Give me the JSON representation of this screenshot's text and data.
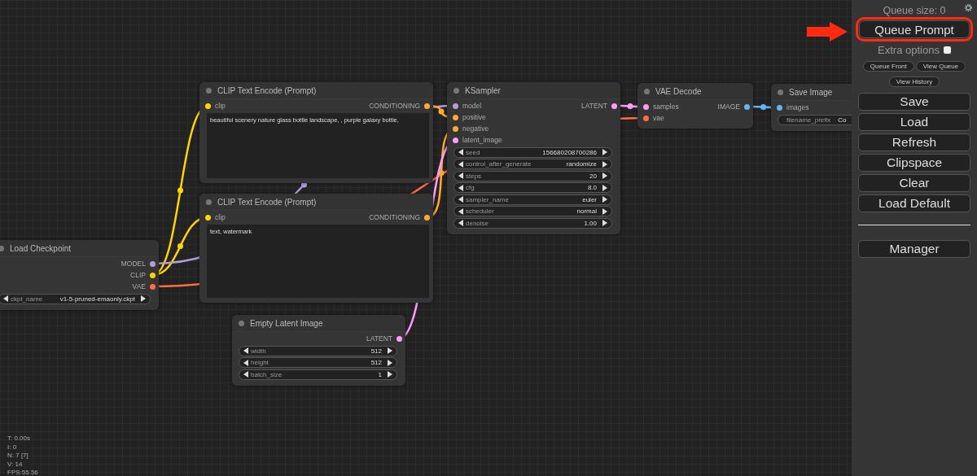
{
  "nodes": [
    {
      "title": "Load Checkpoint",
      "outputs": [
        {
          "name": "MODEL",
          "color": "#b39ddb"
        },
        {
          "name": "CLIP",
          "color": "#ffd500"
        },
        {
          "name": "VAE",
          "color": "#ff6e40"
        }
      ],
      "widgets": [
        {
          "kind": "combo",
          "name": "ckpt_name",
          "value": "v1-5-pruned-emaonly.ckpt"
        }
      ]
    },
    {
      "title": "CLIP Text Encode (Prompt)",
      "inputs": [
        {
          "name": "clip",
          "color": "#ffd500"
        }
      ],
      "outputs": [
        {
          "name": "CONDITIONING",
          "color": "#ffa931"
        }
      ],
      "widgets": [
        {
          "kind": "textarea",
          "value": "beautiful scenery nature glass bottle landscape, , purple galaxy bottle,"
        }
      ]
    },
    {
      "title": "CLIP Text Encode (Prompt)",
      "inputs": [
        {
          "name": "clip",
          "color": "#ffd500"
        }
      ],
      "outputs": [
        {
          "name": "CONDITIONING",
          "color": "#ffa931"
        }
      ],
      "widgets": [
        {
          "kind": "textarea",
          "value": "text, watermark"
        }
      ]
    },
    {
      "title": "KSampler",
      "inputs": [
        {
          "name": "model",
          "color": "#b39ddb"
        },
        {
          "name": "positive",
          "color": "#ffa931"
        },
        {
          "name": "negative",
          "color": "#ffa931"
        },
        {
          "name": "latent_image",
          "color": "#ff9cf9"
        }
      ],
      "outputs": [
        {
          "name": "LATENT",
          "color": "#ff9cf9"
        }
      ],
      "widgets": [
        {
          "kind": "number",
          "name": "seed",
          "value": "156680208700286"
        },
        {
          "kind": "combo",
          "name": "control_after_generate",
          "value": "randomize"
        },
        {
          "kind": "number",
          "name": "steps",
          "value": "20"
        },
        {
          "kind": "number",
          "name": "cfg",
          "value": "8.0"
        },
        {
          "kind": "combo",
          "name": "sampler_name",
          "value": "euler"
        },
        {
          "kind": "combo",
          "name": "scheduler",
          "value": "normal"
        },
        {
          "kind": "number",
          "name": "denoise",
          "value": "1.00"
        }
      ]
    },
    {
      "title": "VAE Decode",
      "inputs": [
        {
          "name": "samples",
          "color": "#ff9cf9"
        },
        {
          "name": "vae",
          "color": "#ff6e40"
        }
      ],
      "outputs": [
        {
          "name": "IMAGE",
          "color": "#64b5f6"
        }
      ]
    },
    {
      "title": "Save Image",
      "inputs": [
        {
          "name": "images",
          "color": "#64b5f6"
        }
      ],
      "widgets": [
        {
          "kind": "text",
          "name": "filename_prefix",
          "value": "Co"
        }
      ]
    },
    {
      "title": "Empty Latent Image",
      "outputs": [
        {
          "name": "LATENT",
          "color": "#ff9cf9"
        }
      ],
      "widgets": [
        {
          "kind": "number",
          "name": "width",
          "value": "512"
        },
        {
          "kind": "number",
          "name": "height",
          "value": "512"
        },
        {
          "kind": "number",
          "name": "batch_size",
          "value": "1"
        }
      ]
    }
  ],
  "stats": [
    "T: 0.00s",
    "I: 0",
    "N: 7 [7]",
    "V: 14",
    "FPS:55.56"
  ],
  "panel": {
    "queue_size": "Queue size: 0",
    "queue_button": {
      "label": "Queue Prompt",
      "highlighted": true
    },
    "extra_options": {
      "label": "Extra options",
      "checked": false
    },
    "small_buttons": [
      "Queue Front",
      "View Queue"
    ],
    "history_button": "View History",
    "buttons": [
      "Save",
      "Load",
      "Refresh",
      "Clipspace",
      "Clear",
      "Load Default"
    ],
    "manager_button": "Manager"
  }
}
